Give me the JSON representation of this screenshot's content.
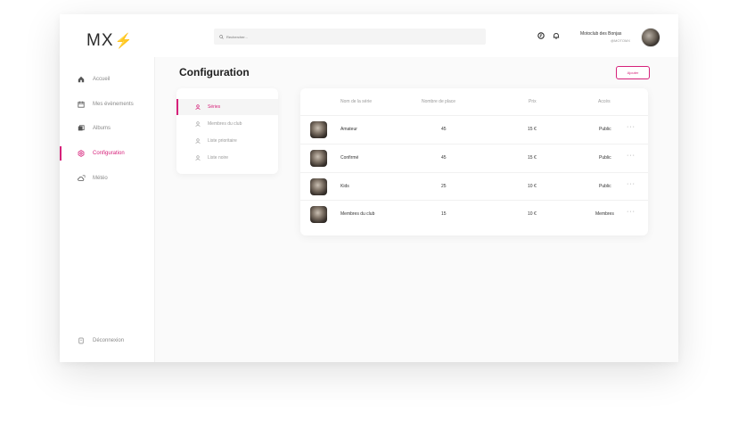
{
  "sidebar": {
    "logo": "MX",
    "items": [
      {
        "label": "Accueil",
        "icon": "home-icon"
      },
      {
        "label": "Mes évènements",
        "icon": "calendar-icon"
      },
      {
        "label": "Albums",
        "icon": "album-icon"
      },
      {
        "label": "Configuration",
        "icon": "gear-icon",
        "active": true
      },
      {
        "label": "Météo",
        "icon": "weather-icon"
      }
    ],
    "logout": "Déconnexion"
  },
  "header": {
    "search_placeholder": "Rechercher...",
    "user_name": "Motoclub des Bonjas",
    "user_sub": "@MOTOMX"
  },
  "main": {
    "title": "Configuration",
    "add_button": "Ajouter",
    "subnav": [
      {
        "label": "Séries",
        "active": true
      },
      {
        "label": "Membres du club"
      },
      {
        "label": "Liste prioritaire"
      },
      {
        "label": "Liste noire"
      }
    ],
    "table": {
      "columns": [
        "Nom de la série",
        "Nombre de place",
        "Prix",
        "Accès"
      ],
      "rows": [
        {
          "name": "Amateur",
          "places": "45",
          "price": "15 €",
          "access": "Public"
        },
        {
          "name": "Confirmé",
          "places": "45",
          "price": "15 €",
          "access": "Public"
        },
        {
          "name": "Kids",
          "places": "25",
          "price": "10 €",
          "access": "Public"
        },
        {
          "name": "Membres du club",
          "places": "15",
          "price": "10 €",
          "access": "Membres"
        }
      ],
      "more_label": "···"
    }
  },
  "colors": {
    "accent": "#d6217a"
  }
}
